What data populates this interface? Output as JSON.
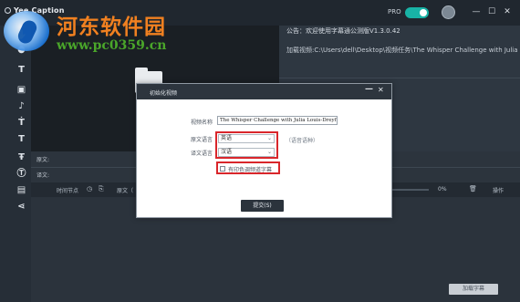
{
  "titlebar": {
    "brand": "Yee Caption",
    "pro_label": "PRO",
    "pro_enabled": true,
    "controls": {
      "minimize_icon": "minus-icon",
      "maximize_icon": "square-icon",
      "close_icon": "close-icon"
    }
  },
  "watermark": {
    "title": "河东软件园",
    "url": "www.pc0359.cn"
  },
  "sidebar": {
    "icons": [
      "hand-icon",
      "mic-icon",
      "text-t-icon",
      "crop-icon",
      "mic-small-icon",
      "text-box-icon",
      "text-t-alt-icon",
      "text-sub-icon",
      "text-replace-icon",
      "save-icon",
      "share-icon"
    ]
  },
  "notice": {
    "announcement": "公告：欢迎使用字幕通公测版V1.3.0.42",
    "loaded_video": "加载视频:C:\\Users\\dell\\Desktop\\视频任务\\The Whisper Challenge with Julia Louis-D"
  },
  "text_panel": {
    "original_label": "原文:",
    "translation_label": "译文:"
  },
  "timeline": {
    "timecode_label": "时间节点",
    "original_label": "原文（",
    "progress": "0%",
    "actions_label": "操作"
  },
  "footer": {
    "load_subtitle_button": "加载字幕"
  },
  "dialog": {
    "title": "初始化视频",
    "minimize": "—",
    "close": "✕",
    "video_name_label": "视频名称",
    "video_name_value": "The Whisper Challenge with Julia Louis-Dreyfus",
    "source_language_label": "原文语言",
    "source_language_value": "英语",
    "target_language_label": "译文语言",
    "target_language_value": "汉语",
    "language_hint": "（语音语种）",
    "hardsub_checkbox_label": "有印色调频道字幕",
    "hardsub_checked": false,
    "submit_button": "提交(S)"
  },
  "colors": {
    "titlebar_bg": "#20272f",
    "sidebar_bg": "#262e37",
    "toggle_on": "#18b3a6",
    "highlight_red": "#d9262b",
    "watermark_orange": "#f08020",
    "watermark_green": "#4aa62a"
  }
}
